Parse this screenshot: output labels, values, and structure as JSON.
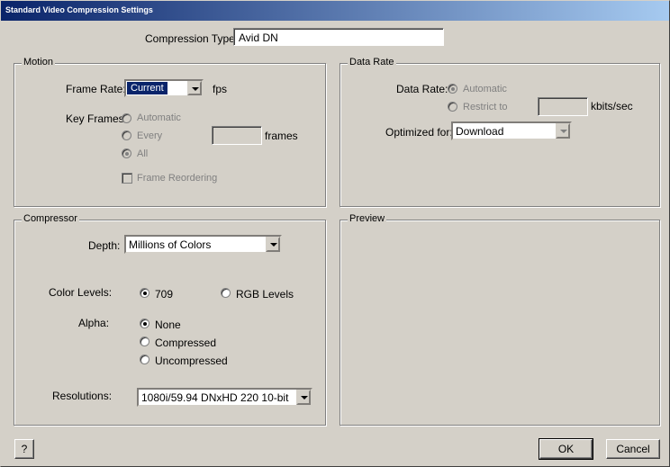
{
  "window": {
    "title": "Standard Video Compression Settings"
  },
  "compression": {
    "label": "Compression Type:",
    "value": "Avid DN"
  },
  "motion": {
    "legend": "Motion",
    "frame_rate_label": "Frame Rate:",
    "frame_rate_value": "Current",
    "fps_label": "fps",
    "key_frames_label": "Key Frames:",
    "kf_automatic": "Automatic",
    "kf_every": "Every",
    "kf_all": "All",
    "frames_label": "frames",
    "frame_reordering": "Frame Reordering"
  },
  "data_rate": {
    "legend": "Data Rate",
    "label": "Data Rate:",
    "automatic": "Automatic",
    "restrict_to": "Restrict to",
    "unit": "kbits/sec",
    "optimized_label": "Optimized for:",
    "optimized_value": "Download"
  },
  "compressor": {
    "legend": "Compressor",
    "depth_label": "Depth:",
    "depth_value": "Millions of Colors",
    "color_levels_label": "Color Levels:",
    "cl_709": "709",
    "cl_rgb": "RGB Levels",
    "alpha_label": "Alpha:",
    "alpha_none": "None",
    "alpha_compressed": "Compressed",
    "alpha_uncompressed": "Uncompressed",
    "resolutions_label": "Resolutions:",
    "resolutions_value": "1080i/59.94  DNxHD 220 10-bit"
  },
  "preview": {
    "legend": "Preview"
  },
  "buttons": {
    "help": "?",
    "ok": "OK",
    "cancel": "Cancel"
  }
}
